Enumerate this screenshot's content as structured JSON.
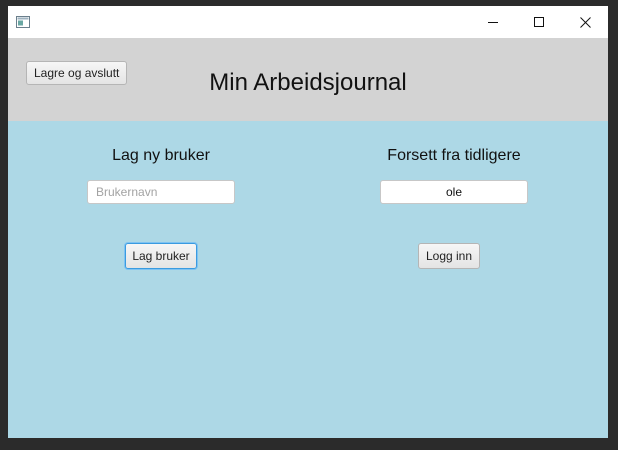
{
  "titlebar": {
    "icons": {
      "app": "app-window-icon",
      "minimize": "minimize-icon",
      "maximize": "maximize-icon",
      "close": "close-icon"
    }
  },
  "header": {
    "save_button_label": "Lagre og avslutt",
    "title": "Min Arbeidsjournal"
  },
  "new_user": {
    "heading": "Lag ny bruker",
    "username_placeholder": "Brukernavn",
    "username_value": "",
    "create_button_label": "Lag bruker"
  },
  "continue": {
    "heading": "Forsett fra tidligere",
    "username_value": "ole",
    "login_button_label": "Logg inn"
  },
  "colors": {
    "header_bg": "#d3d3d3",
    "main_bg": "#add8e6",
    "focus_accent": "#3a9be0"
  }
}
